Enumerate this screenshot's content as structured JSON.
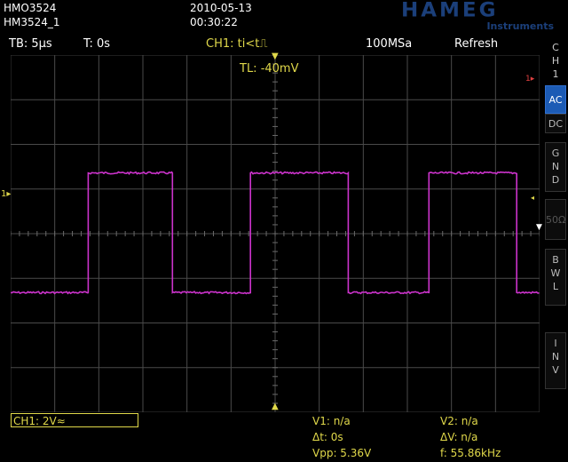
{
  "header": {
    "model": "HMO3524",
    "device_name": "HM3524_1",
    "date": "2010-05-13",
    "time": "00:30:22",
    "brand": "HAMEG",
    "brand_sub": "Instruments"
  },
  "statusbar": {
    "timebase": "TB: 5µs",
    "trigger_time": "T: 0s",
    "trigger": "CH1: ti<t⎍",
    "sample_rate": "100MSa",
    "acq_mode": "Refresh"
  },
  "waveform": {
    "trigger_level_label": "TL: -40mV",
    "ch1_marker": "1▸",
    "ref_marker": "1▸",
    "color": "#cc33cc",
    "grid_color": "#4a4a4a",
    "high_level_v": 2.72,
    "low_level_v": -2.64,
    "volts_per_div": 2,
    "time_per_div_us": 5
  },
  "rightbar": {
    "channel": "CH1",
    "buttons": [
      {
        "label": "AC",
        "active": true
      },
      {
        "label": "DC",
        "active": false
      },
      {
        "label": "GND",
        "active": false
      },
      {
        "label": "50Ω",
        "active": false
      },
      {
        "label": "BWL",
        "active": false
      },
      {
        "label": "INV",
        "active": false
      }
    ]
  },
  "footer": {
    "ch1_setting": "CH1: 2V≈",
    "v1": "V1: n/a",
    "v2": "V2: n/a",
    "dt": "Δt: 0s",
    "dv": "ΔV: n/a",
    "vpp": "Vpp: 5.36V",
    "freq": "f: 55.86kHz"
  },
  "colors": {
    "accent": "#e0d84a",
    "active_button": "#1c5bb5",
    "brand": "#1b3f7a"
  }
}
